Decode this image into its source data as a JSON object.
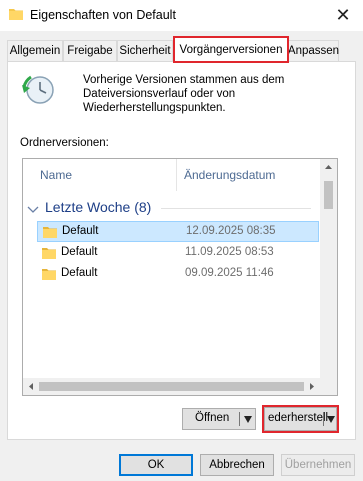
{
  "window": {
    "title": "Eigenschaften von Default",
    "close_glyph": "✕"
  },
  "tabs": [
    {
      "label": "Allgemein",
      "active": false
    },
    {
      "label": "Freigabe",
      "active": false
    },
    {
      "label": "Sicherheit",
      "active": false
    },
    {
      "label": "Vorgängerversionen",
      "active": true
    },
    {
      "label": "Anpassen",
      "active": false
    }
  ],
  "description": "Vorherige Versionen stammen aus dem Dateiversionsverlauf oder von Wiederherstellungspunkten.",
  "versions_label": "Ordnerversionen:",
  "list": {
    "columns": [
      "Name",
      "Änderungsdatum"
    ],
    "group": "Letzte Woche (8)",
    "rows": [
      {
        "name": "Default",
        "date": "12.09.2025 08:35",
        "selected": true
      },
      {
        "name": "Default",
        "date": "11.09.2025 08:53",
        "selected": false
      },
      {
        "name": "Default",
        "date": "09.09.2025 11:46",
        "selected": false
      }
    ]
  },
  "actions": {
    "open": "Öffnen",
    "restore": "ederherstell"
  },
  "footer": {
    "ok": "OK",
    "cancel": "Abbrechen",
    "apply": "Übernehmen"
  },
  "colors": {
    "highlight": "#e0262d",
    "selection": "#cce8ff",
    "group": "#1e3f87",
    "folder": "#f5c84c"
  }
}
